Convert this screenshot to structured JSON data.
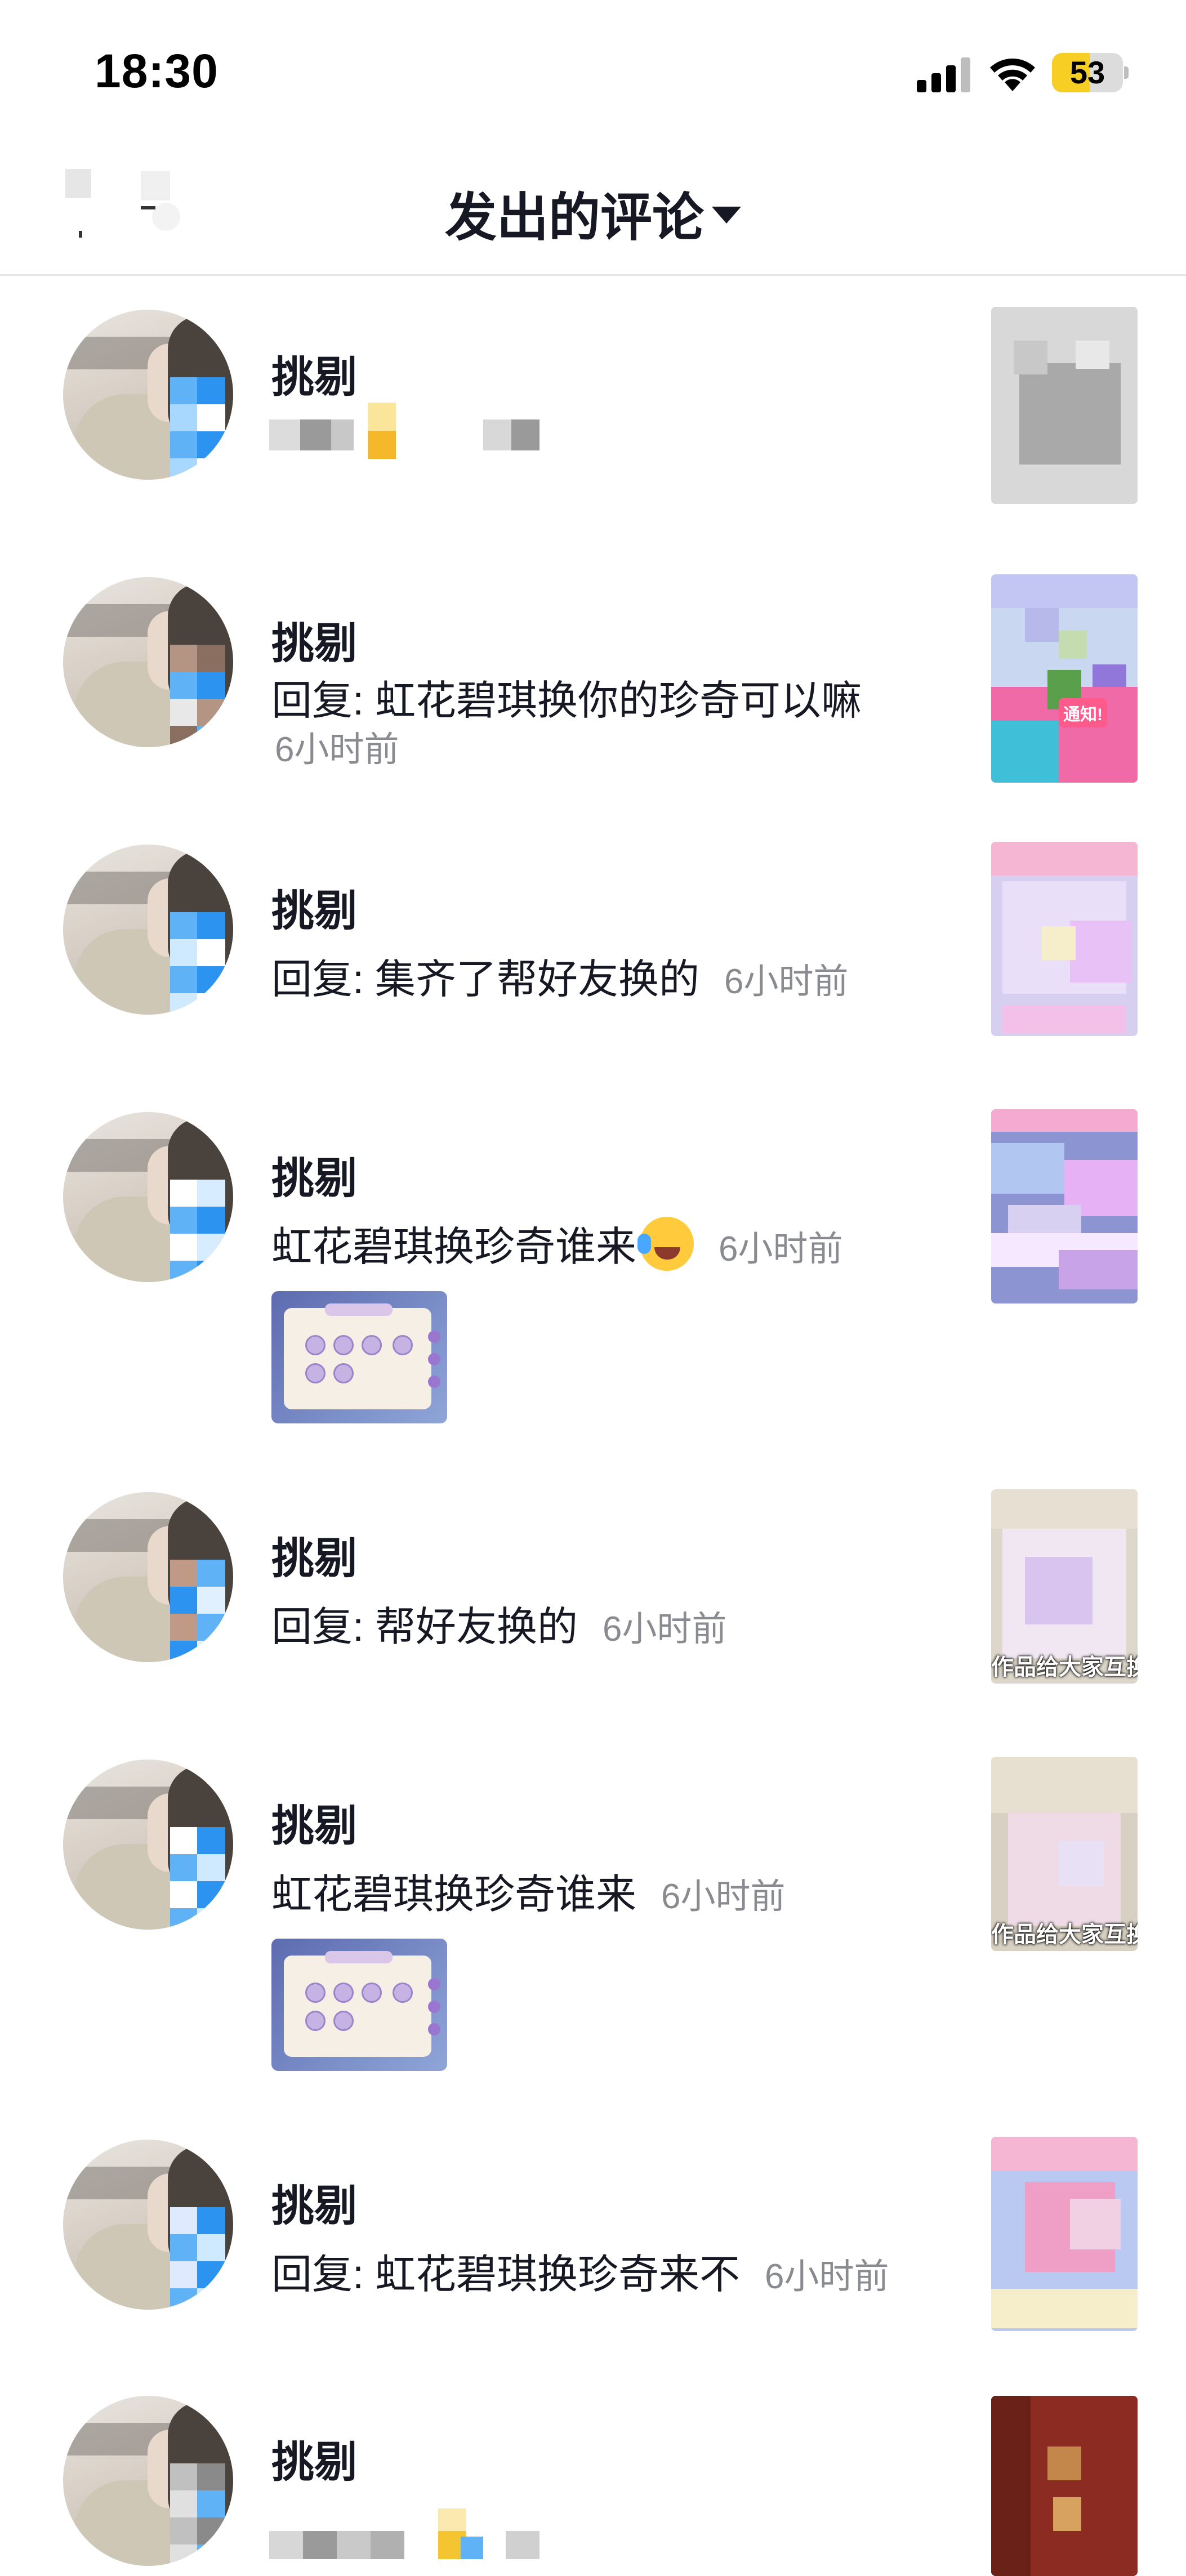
{
  "status_bar": {
    "time": "18:30",
    "battery_level": "53",
    "battery_color": "#f7ce23"
  },
  "header": {
    "title": "发出的评论",
    "back_icon": "back-arrow-icon",
    "dropdown_icon": "caret-down-icon"
  },
  "comments": [
    {
      "author": "挑剔",
      "text": "",
      "time": "",
      "has_attachment": false
    },
    {
      "author": "挑剔",
      "text": "回复: 虹花碧琪换你的珍奇可以嘛",
      "time": "6小时前",
      "has_attachment": false
    },
    {
      "author": "挑剔",
      "text": "回复: 集齐了帮好友换的",
      "time": "6小时前",
      "has_attachment": false
    },
    {
      "author": "挑剔",
      "text": "虹花碧琪换珍奇谁来",
      "time": "6小时前",
      "emoji": "laughing-tears-emoji",
      "has_attachment": true
    },
    {
      "author": "挑剔",
      "text": "回复: 帮好友换的",
      "time": "6小时前",
      "has_attachment": false,
      "thumb_caption": "作品给大家互换"
    },
    {
      "author": "挑剔",
      "text": "虹花碧琪换珍奇谁来",
      "time": "6小时前",
      "has_attachment": true,
      "thumb_caption": "作品给大家互换"
    },
    {
      "author": "挑剔",
      "text": "回复: 虹花碧琪换珍奇来不",
      "time": "6小时前",
      "has_attachment": false
    },
    {
      "author": "挑剔",
      "text": "",
      "time": "",
      "has_attachment": false
    }
  ],
  "thumb_badge": "通知!"
}
